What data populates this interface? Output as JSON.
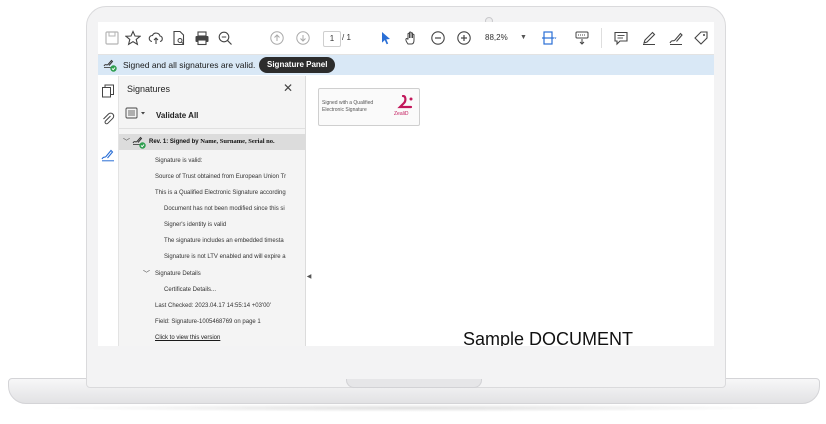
{
  "toolbar": {
    "page_current": "1",
    "page_total": "/ 1",
    "zoom": "88,2%"
  },
  "signature_bar": {
    "status_text": "Signed and all signatures are valid.",
    "panel_button": "Signature Panel"
  },
  "signatures_panel": {
    "title": "Signatures",
    "close": "✕",
    "validate_all": "Validate All",
    "revision": {
      "prefix": "Rev. 1: Signed by",
      "signer": "Name, Surname, Serial no."
    },
    "items": [
      "Signature is valid:",
      "Source of Trust obtained from European Union Tr",
      "This is a Qualified Electronic Signature according"
    ],
    "sub_items": [
      "Document has not been modified since this si",
      "Signer's identity is valid",
      "The signature includes an embedded timesta",
      "Signature is not LTV enabled and will expire a"
    ],
    "details_label": "Signature Details",
    "certificate_details": "Certificate Details...",
    "last_checked": "Last Checked: 2023.04.17 14:55:14 +03'00'",
    "field": "Field: Signature-1005468769 on page 1",
    "view_version": "Click to view this version"
  },
  "document": {
    "stamp_text": "Signed with a Qualified Electronic Signature",
    "stamp_brand": "ZealiD",
    "title": "Sample DOCUMENT"
  },
  "colors": {
    "signature_bar_bg": "#d9e8f6",
    "accent_blue": "#2a6fd6",
    "valid_green": "#2e9e4f",
    "brand_pink": "#c2185b"
  }
}
